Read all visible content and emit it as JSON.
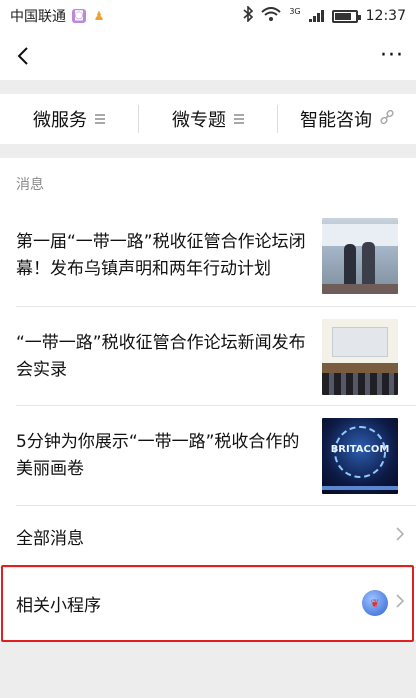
{
  "status_bar": {
    "carrier": "中国联通",
    "network": "3G",
    "time": "12:37",
    "battery_level": 0.8
  },
  "nav": {
    "back_icon": "back-chevron-icon",
    "more_label": "···"
  },
  "menu": {
    "items": [
      {
        "label": "微服务",
        "icon": "menu-lines-icon"
      },
      {
        "label": "微专题",
        "icon": "menu-lines-icon"
      },
      {
        "label": "智能咨询",
        "icon": "link-icon"
      }
    ]
  },
  "messages": {
    "section_label": "消息",
    "items": [
      {
        "title": "第一届“一带一路”税收征管合作论坛闭幕！发布乌镇声明和两年行动计划"
      },
      {
        "title": "“一带一路”税收征管合作论坛新闻发布会实录"
      },
      {
        "title": "5分钟为你展示“一带一路”税收合作的美丽画卷"
      }
    ],
    "thumb3_word": "BRITACOM"
  },
  "links": {
    "all_messages": "全部消息",
    "related_miniprograms": "相关小程序"
  },
  "colors": {
    "highlight": "#e02020",
    "background": "#ededed"
  }
}
